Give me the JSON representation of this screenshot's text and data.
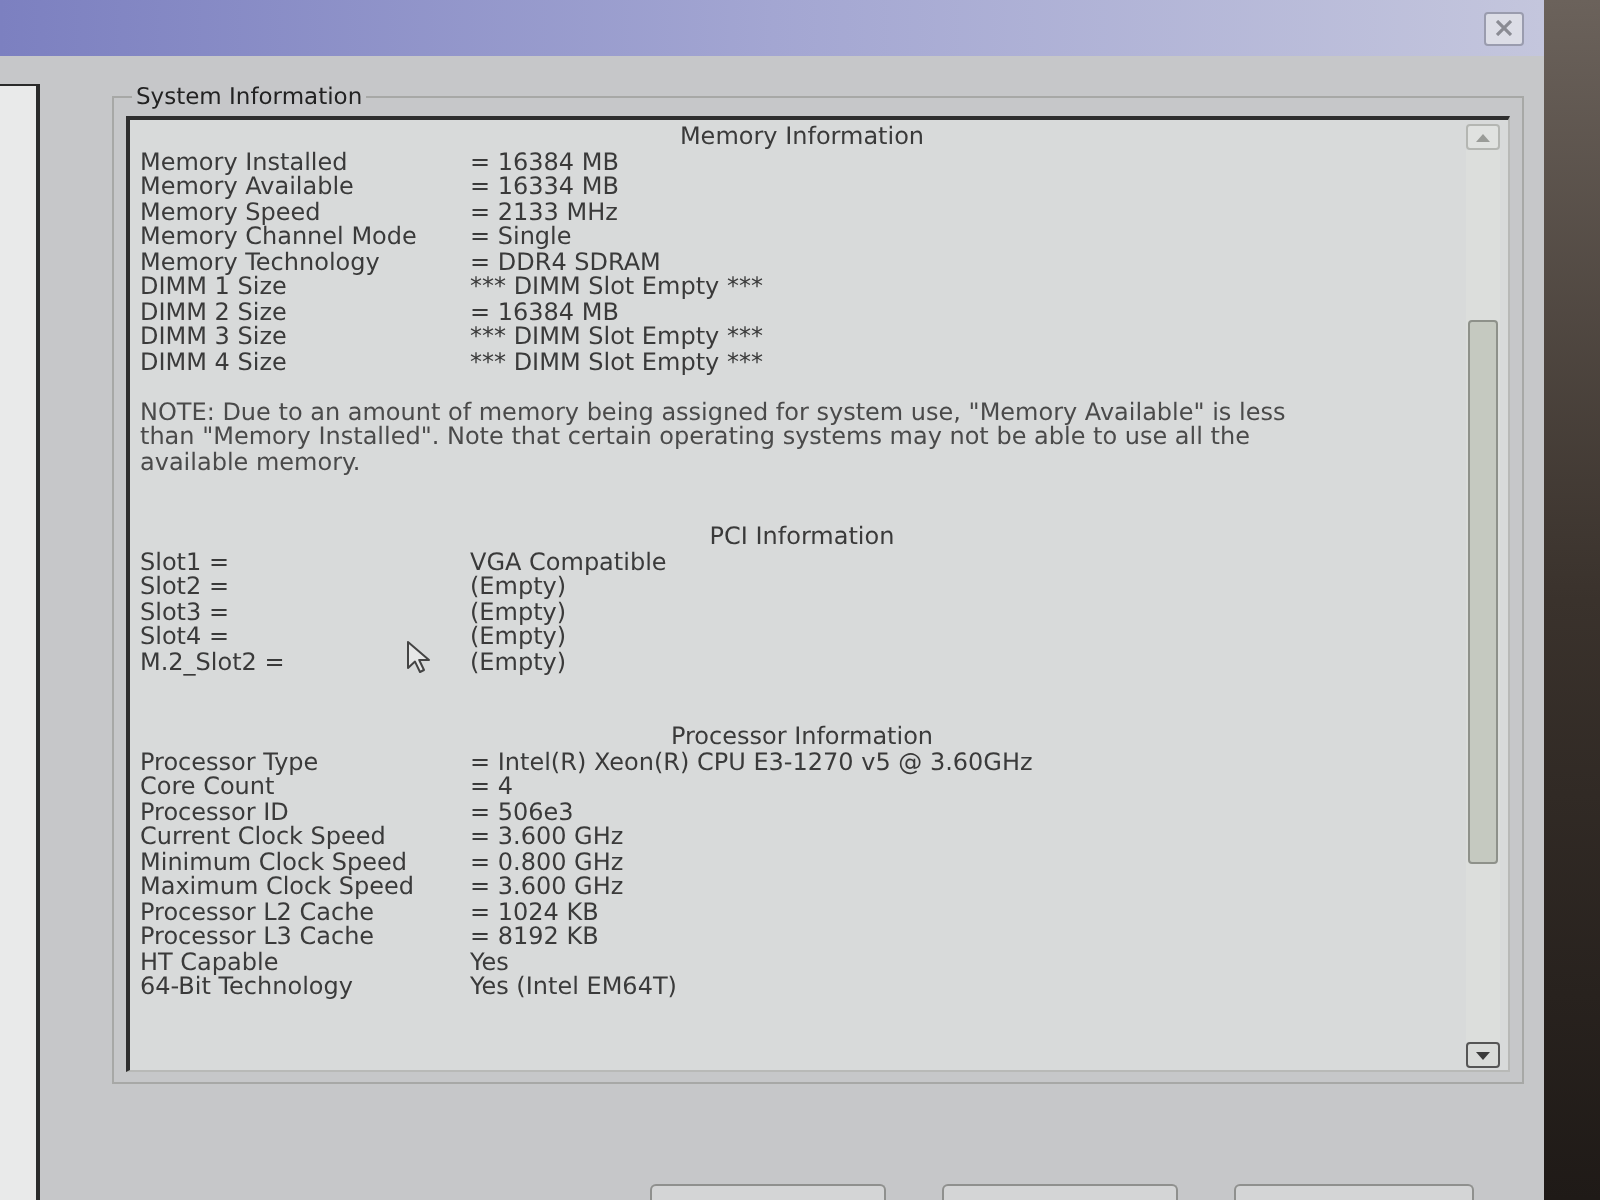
{
  "group": {
    "title": "System Information"
  },
  "sections": [
    {
      "kind": "table",
      "heading": "Memory Information",
      "rows": [
        {
          "label": "Memory Installed",
          "value": "= 16384 MB"
        },
        {
          "label": "Memory Available",
          "value": "= 16334 MB"
        },
        {
          "label": "Memory Speed",
          "value": "= 2133 MHz"
        },
        {
          "label": "Memory Channel Mode",
          "value": "= Single"
        },
        {
          "label": "Memory Technology",
          "value": "= DDR4 SDRAM"
        },
        {
          "label": "DIMM 1 Size",
          "value": "*** DIMM Slot Empty ***"
        },
        {
          "label": "DIMM 2 Size",
          "value": "= 16384 MB"
        },
        {
          "label": "DIMM 3 Size",
          "value": "*** DIMM Slot Empty ***"
        },
        {
          "label": "DIMM 4 Size",
          "value": "*** DIMM Slot Empty ***"
        }
      ]
    },
    {
      "kind": "note",
      "text": "NOTE: Due to an amount of memory being assigned for system use, \"Memory Available\" is less than \"Memory Installed\". Note that certain operating systems may not be able to use all the available memory."
    },
    {
      "kind": "table",
      "heading": "PCI Information",
      "rows": [
        {
          "label": "Slot1 =",
          "value": "VGA Compatible"
        },
        {
          "label": "Slot2 =",
          "value": "(Empty)"
        },
        {
          "label": "Slot3 =",
          "value": "(Empty)"
        },
        {
          "label": "Slot4 =",
          "value": "(Empty)"
        },
        {
          "label": "M.2_Slot2 =",
          "value": "(Empty)"
        }
      ]
    },
    {
      "kind": "table",
      "heading": "Processor Information",
      "rows": [
        {
          "label": "Processor Type",
          "value": "= Intel(R) Xeon(R) CPU E3-1270 v5 @ 3.60GHz"
        },
        {
          "label": "Core Count",
          "value": "= 4"
        },
        {
          "label": "Processor ID",
          "value": "= 506e3"
        },
        {
          "label": "Current Clock Speed",
          "value": "= 3.600 GHz"
        },
        {
          "label": "Minimum Clock Speed",
          "value": "= 0.800 GHz"
        },
        {
          "label": "Maximum Clock Speed",
          "value": "= 3.600 GHz"
        },
        {
          "label": "Processor L2 Cache",
          "value": "= 1024 KB"
        },
        {
          "label": "Processor L3 Cache",
          "value": "= 8192 KB"
        },
        {
          "label": "HT Capable",
          "value": "Yes"
        },
        {
          "label": "64-Bit Technology",
          "value": "Yes (Intel EM64T)"
        }
      ]
    }
  ]
}
